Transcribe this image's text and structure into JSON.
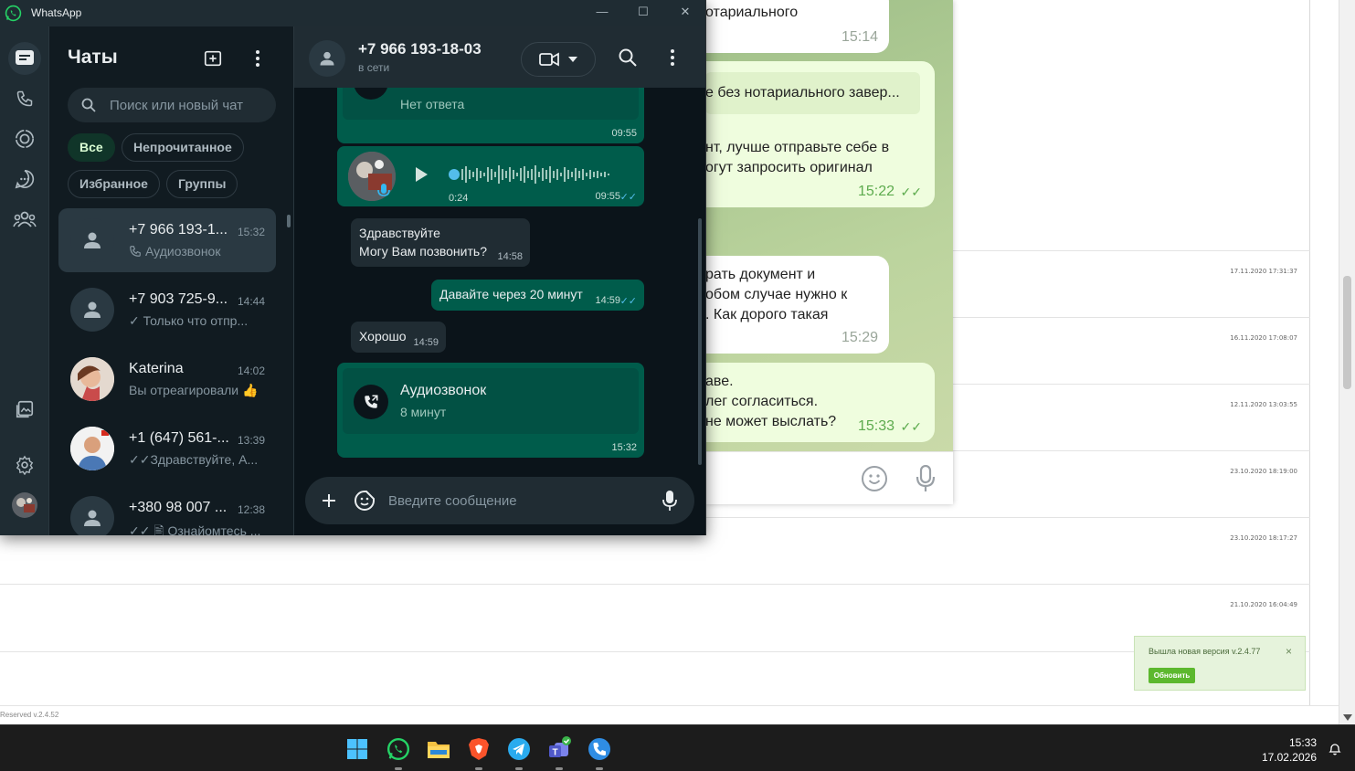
{
  "background": {
    "dates": [
      "17.11.2020 17:31:37",
      "16.11.2020 17:08:07",
      "12.11.2020 13:03:55",
      "23.10.2020 18:19:00",
      "23.10.2020 18:17:27",
      "21.10.2020 16:04:49"
    ],
    "footer_text": "Reserved v.2.4.52",
    "toast": {
      "text": "Вышла новая версия v.2.4.77",
      "button": "Обновить",
      "close": "×"
    }
  },
  "telegram": {
    "messages": [
      {
        "lines": [
          "отариального"
        ],
        "time": "15:14",
        "mine": false
      },
      {
        "quote": "е без  нотариального завер...",
        "lines": [
          "нт, лучше отправьте себе в",
          "огут запросить оригинал"
        ],
        "time": "15:22",
        "mine": true
      },
      {
        "lines": [
          "рать документ и",
          "обом случае нужно к",
          ". Как дорого такая"
        ],
        "time": "15:29",
        "mine": false
      },
      {
        "lines": [
          "аве.",
          "лег согласиться.",
          "не может выслать?"
        ],
        "time": "15:33",
        "mine": true
      }
    ]
  },
  "whatsapp": {
    "app_title": "WhatsApp",
    "window_controls": {
      "minimize": "—",
      "maximize": "☐",
      "close": "✕"
    },
    "list": {
      "title": "Чаты",
      "search_placeholder": "Поиск или новый чат",
      "filters": [
        "Все",
        "Непрочитанное",
        "Избранное",
        "Группы"
      ],
      "chats": [
        {
          "name": "+7 966 193-1...",
          "time": "15:32",
          "preview": "Аудиозвонок",
          "icon": "phone-icon"
        },
        {
          "name": "+7 903 725-9...",
          "time": "14:44",
          "preview": "✓ Только что отпр...",
          "icon": ""
        },
        {
          "name": "Katerina",
          "time": "14:02",
          "preview": "Вы отреагировали 👍",
          "icon": ""
        },
        {
          "name": "+1 (647) 561-...",
          "time": "13:39",
          "preview": "✓✓Здравствуйте, А...",
          "icon": ""
        },
        {
          "name": "+380 98 007 ...",
          "time": "12:38",
          "preview": "✓✓ 🖹 Ознайомтесь ...",
          "icon": ""
        }
      ]
    },
    "chat": {
      "contact": "+7 966 193-18-03",
      "status": "в сети",
      "messages": {
        "call1_title": "Нет ответа",
        "call1_time": "09:55",
        "voice_duration": "0:24",
        "voice_time": "09:55",
        "m1_line1": "Здравствуйте",
        "m1_line2": "Могу Вам позвонить?",
        "m1_time": "14:58",
        "m2_text": "Давайте через 20 минут",
        "m2_time": "14:59",
        "m3_text": "Хорошо",
        "m3_time": "14:59",
        "call2_title": "Аудиозвонок",
        "call2_sub": "8 минут",
        "call2_time": "15:32"
      },
      "composer_placeholder": "Введите сообщение"
    }
  },
  "taskbar": {
    "apps": [
      "windows-start",
      "whatsapp",
      "file-explorer",
      "brave",
      "telegram",
      "teams",
      "phone-app"
    ],
    "time": "15:33",
    "date": "17.02.2026"
  }
}
